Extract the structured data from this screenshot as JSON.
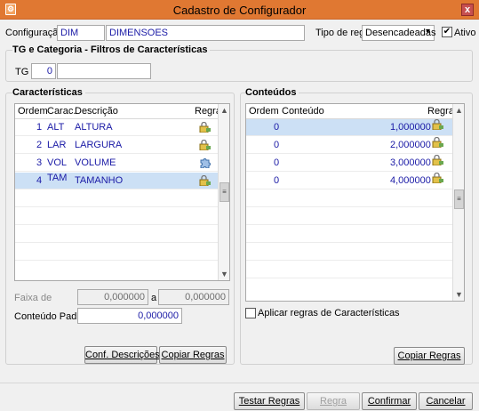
{
  "window": {
    "title": "Cadastro de Configurador",
    "app_icon": "app-icon",
    "close_label": "x"
  },
  "header": {
    "config_label": "Configuração",
    "config_code": "DIM",
    "config_name": "DIMENSOES",
    "rule_type_label": "Tipo de regra",
    "rule_type_value": "Desencadeadas",
    "active_label": "Ativo",
    "active_checked": true
  },
  "tg_group": {
    "title": "TG e Categoria - Filtros de Características",
    "tg_label": "TG",
    "tg_value": "0",
    "tg_desc": ""
  },
  "characteristics": {
    "title": "Características",
    "columns": [
      "Ordem",
      "Carac.",
      "Descrição",
      "Regra"
    ],
    "rows": [
      {
        "ordem": "1",
        "carac": "ALT",
        "descricao": "ALTURA",
        "regra_icon": "lock-icon"
      },
      {
        "ordem": "2",
        "carac": "LAR",
        "descricao": "LARGURA",
        "regra_icon": "lock-icon"
      },
      {
        "ordem": "3",
        "carac": "VOL",
        "descricao": "VOLUME",
        "regra_icon": "puzzle-icon"
      },
      {
        "ordem": "4",
        "carac": "TAM",
        "descricao": "TAMANHO",
        "regra_icon": "lock-icon",
        "selected": true
      }
    ],
    "range_label": "Faixa de",
    "range_from": "0,000000",
    "range_sep": "a",
    "range_to": "0,000000",
    "default_label": "Conteúdo Padrão",
    "default_value": "0,000000",
    "btn_descriptions": "Conf. Descrições",
    "btn_copy_rules": "Copiar Regras"
  },
  "contents": {
    "title": "Conteúdos",
    "columns": [
      "Ordem",
      "Conteúdo",
      "Regra"
    ],
    "rows": [
      {
        "ordem": "0",
        "conteudo": "1,000000",
        "regra_icon": "lock-icon",
        "selected": true
      },
      {
        "ordem": "0",
        "conteudo": "2,000000",
        "regra_icon": "lock-icon"
      },
      {
        "ordem": "0",
        "conteudo": "3,000000",
        "regra_icon": "lock-icon"
      },
      {
        "ordem": "0",
        "conteudo": "4,000000",
        "regra_icon": "lock-icon"
      }
    ],
    "apply_label": "Aplicar regras de Características",
    "apply_checked": false,
    "btn_copy_rules": "Copiar Regras"
  },
  "footer": {
    "test_rules": "Testar Regras",
    "rule": "Regra",
    "confirm": "Confirmar",
    "cancel": "Cancelar"
  }
}
